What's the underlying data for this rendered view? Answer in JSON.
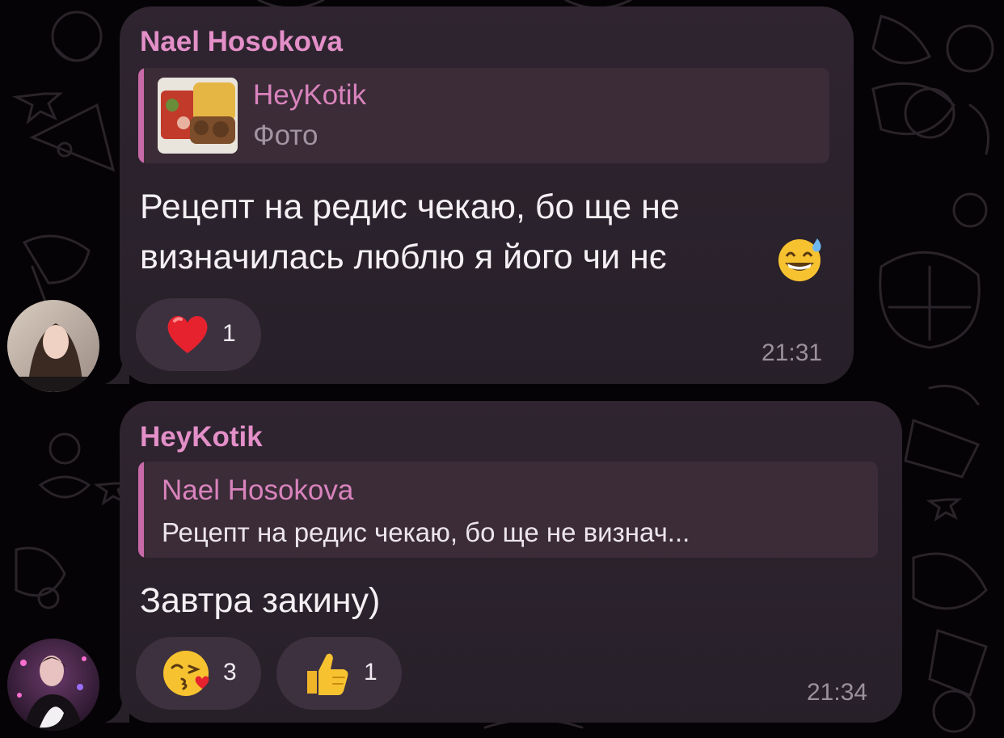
{
  "messages": [
    {
      "sender": "Nael Hosokova",
      "reply": {
        "author": "HeyKotik",
        "preview": "Фото",
        "thumbnail": "food-photo-thumbnail"
      },
      "text_line1": "Рецепт на редис чекаю, бо ще не",
      "text_line2": "визначилась люблю я його чи нє",
      "text_emoji": "grinning-face-with-sweat",
      "reactions": [
        {
          "emoji": "red-heart",
          "count": "1"
        }
      ],
      "time": "21:31"
    },
    {
      "sender": "HeyKotik",
      "reply": {
        "author": "Nael Hosokova",
        "preview": "Рецепт на редис чекаю, бо ще не визнач..."
      },
      "text": "Завтра закину)",
      "reactions": [
        {
          "emoji": "face-blowing-kiss",
          "count": "3"
        },
        {
          "emoji": "thumbs-up",
          "count": "1"
        }
      ],
      "time": "21:34"
    }
  ],
  "colors": {
    "accent": "#e38fc8",
    "bubble": "#2b2230",
    "background": "#050305"
  }
}
